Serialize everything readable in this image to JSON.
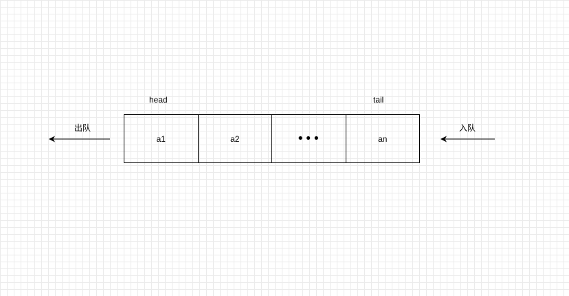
{
  "diagram": {
    "labels": {
      "head": "head",
      "tail": "tail",
      "dequeue": "出队",
      "enqueue": "入队"
    },
    "cells": [
      {
        "text": "a1"
      },
      {
        "text": "a2"
      },
      {
        "text": "•••"
      },
      {
        "text": "an"
      }
    ]
  }
}
